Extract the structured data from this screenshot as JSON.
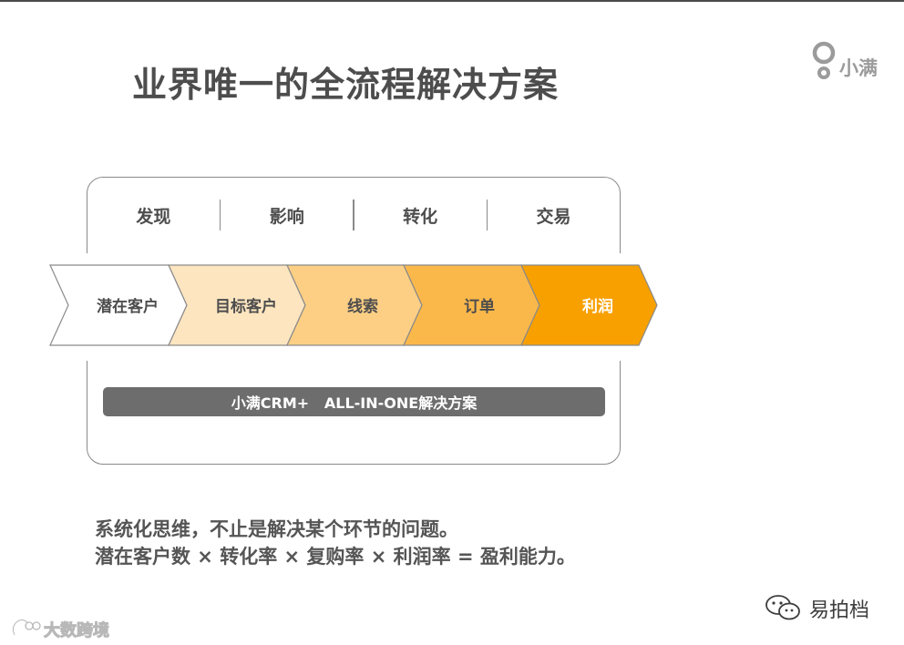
{
  "title": "业界唯一的全流程解决方案",
  "logo": {
    "text": "小满"
  },
  "stages": [
    "发现",
    "影响",
    "转化",
    "交易"
  ],
  "flow": [
    {
      "label": "潜在客户",
      "fill": "#ffffff",
      "text_color": "#4d4d4d"
    },
    {
      "label": "目标客户",
      "fill": "#fde5c0",
      "text_color": "#4d4d4d"
    },
    {
      "label": "线索",
      "fill": "#fccf85",
      "text_color": "#4d4d4d"
    },
    {
      "label": "订单",
      "fill": "#fbb84a",
      "text_color": "#4d4d4d"
    },
    {
      "label": "利润",
      "fill": "#f7a000",
      "text_color": "#ffffff"
    }
  ],
  "solution_bar": "小满CRM+   ALL-IN-ONE解决方案",
  "description": [
    "系统化思维，不止是解决某个环节的问题。",
    "潜在客户数 × 转化率 × 复购率 × 利润率 = 盈利能力。"
  ],
  "watermark_right": "易拍档",
  "watermark_left": "大数跨境",
  "colors": {
    "accent": "#f7a000",
    "text": "#4d4d4d",
    "bar": "#6d6d6d",
    "frame": "#8a8a8a"
  }
}
